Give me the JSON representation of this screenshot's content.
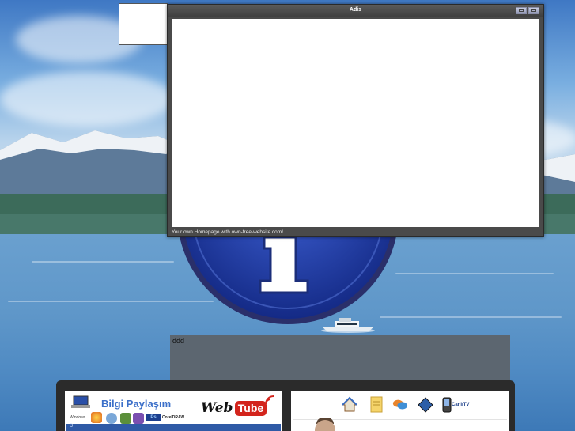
{
  "popup": {
    "title": "Adis",
    "footer_text": "Your own Homepage with own-free-website.com!",
    "minimize_icon": "minimize-icon",
    "close_icon": "close-icon"
  },
  "content_box": {
    "text": "ddd"
  },
  "left_banner": {
    "title": "Bilgi Paylaşım",
    "web_label": "Web",
    "tube_label": "Tube",
    "windows_label": "Windows",
    "ps_label": "Ps",
    "corel_label": "CorelDRAW",
    "strip_text": "D"
  },
  "right_banner": {
    "icons": [
      "home-icon",
      "document-icon",
      "chat-icon",
      "film-icon",
      "phone-icon"
    ],
    "phone_label": "CanlıTV"
  },
  "colors": {
    "popup_frame": "#4a4a4a",
    "ddd_box": "#5c6670",
    "bottom_bar": "#2b2b2b",
    "logo_blue": "#1e3aa8",
    "tube_red": "#d3241c",
    "banner_blue": "#3b6fc9"
  }
}
